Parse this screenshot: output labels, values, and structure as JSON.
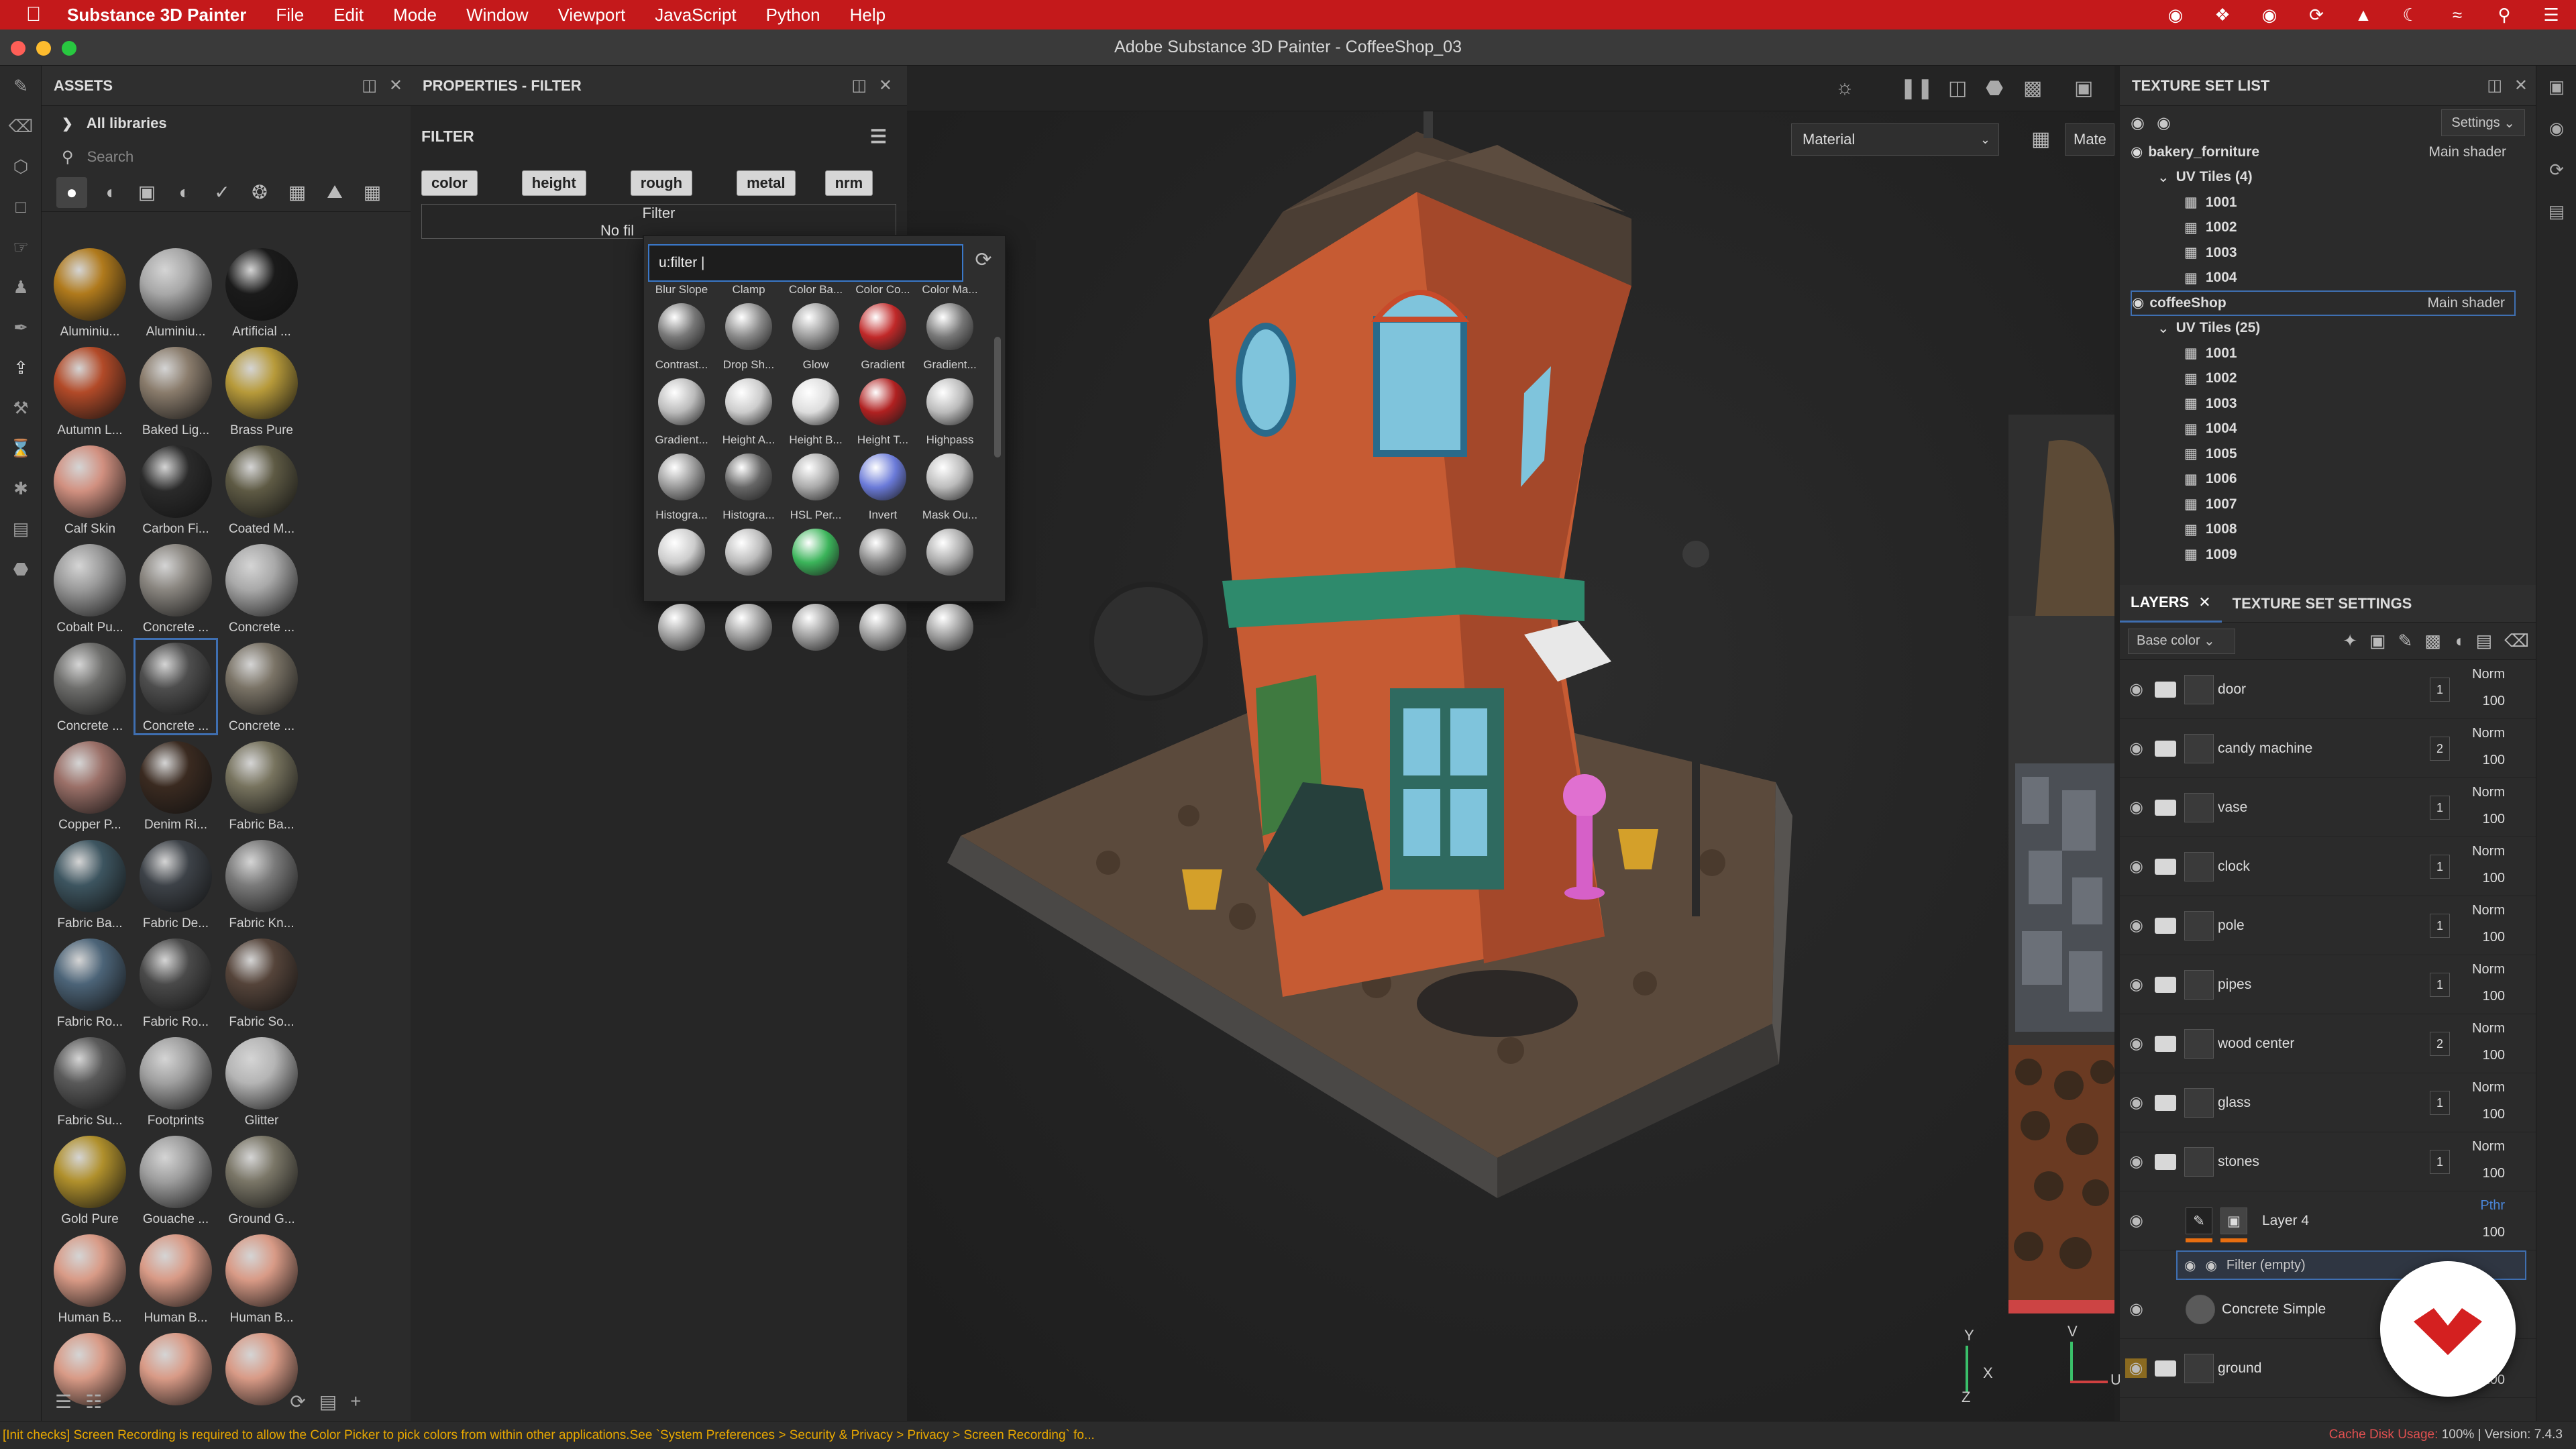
{
  "os_menu": {
    "app_name": "Substance 3D Painter",
    "items": [
      "File",
      "Edit",
      "Mode",
      "Window",
      "Viewport",
      "JavaScript",
      "Python",
      "Help"
    ]
  },
  "window": {
    "title": "Adobe Substance 3D Painter - CoffeeShop_03"
  },
  "assets": {
    "header": "ASSETS",
    "library": "All libraries",
    "search_placeholder": "Search",
    "items": [
      {
        "label": "Aluminiu...",
        "color": "#b07a1c"
      },
      {
        "label": "Aluminiu...",
        "color": "#a8a8a8"
      },
      {
        "label": "Artificial ...",
        "color": "#1a1a1a"
      },
      {
        "label": "Autumn L...",
        "color": "#b24a28"
      },
      {
        "label": "Baked Lig...",
        "color": "#8a7c6c"
      },
      {
        "label": "Brass Pure",
        "color": "#b79a3a"
      },
      {
        "label": "Calf Skin",
        "color": "#d19080"
      },
      {
        "label": "Carbon Fi...",
        "color": "#2a2a2a"
      },
      {
        "label": "Coated M...",
        "color": "#5e5a44"
      },
      {
        "label": "Cobalt Pu...",
        "color": "#9a9a9a"
      },
      {
        "label": "Concrete ...",
        "color": "#8a8680"
      },
      {
        "label": "Concrete ...",
        "color": "#a9a9a9"
      },
      {
        "label": "Concrete ...",
        "color": "#6e6e6c"
      },
      {
        "label": "Concrete ...",
        "color": "#4e4e4e"
      },
      {
        "label": "Concrete ...",
        "color": "#7a7366"
      },
      {
        "label": "Copper P...",
        "color": "#9b7068"
      },
      {
        "label": "Denim Ri...",
        "color": "#3a2a20"
      },
      {
        "label": "Fabric Ba...",
        "color": "#77735e"
      },
      {
        "label": "Fabric Ba...",
        "color": "#3d5560"
      },
      {
        "label": "Fabric De...",
        "color": "#3d4248"
      },
      {
        "label": "Fabric Kn...",
        "color": "#7a7a7a"
      },
      {
        "label": "Fabric Ro...",
        "color": "#4c6478"
      },
      {
        "label": "Fabric Ro...",
        "color": "#4a4a4a"
      },
      {
        "label": "Fabric So...",
        "color": "#55443a"
      },
      {
        "label": "Fabric Su...",
        "color": "#5a5a5a"
      },
      {
        "label": "Footprints",
        "color": "#a0a0a0"
      },
      {
        "label": "Glitter",
        "color": "#b5b5b5"
      },
      {
        "label": "Gold Pure",
        "color": "#b0902c"
      },
      {
        "label": "Gouache ...",
        "color": "#9e9e9e"
      },
      {
        "label": "Ground G...",
        "color": "#7a7667"
      },
      {
        "label": "Human B...",
        "color": "#d89a86"
      },
      {
        "label": "Human B...",
        "color": "#d89a86"
      },
      {
        "label": "Human B...",
        "color": "#d89a86"
      },
      {
        "label": "",
        "color": "#d89a86"
      },
      {
        "label": "",
        "color": "#d89a86"
      },
      {
        "label": "",
        "color": "#d89a86"
      }
    ]
  },
  "properties": {
    "header": "PROPERTIES - FILTER",
    "section": "FILTER",
    "channels": [
      "color",
      "height",
      "rough",
      "metal",
      "nrm"
    ],
    "filter_label": "Filter",
    "filter_value": "No fil"
  },
  "filter_popup": {
    "query": "u:filter |",
    "items": [
      {
        "label": "Blur Slope",
        "color": "#777"
      },
      {
        "label": "Clamp",
        "color": "#888"
      },
      {
        "label": "Color Ba...",
        "color": "#999"
      },
      {
        "label": "Color Co...",
        "color": "#c02828"
      },
      {
        "label": "Color Ma...",
        "color": "#777"
      },
      {
        "label": "Contrast...",
        "color": "#bbb"
      },
      {
        "label": "Drop Sh...",
        "color": "#ccc"
      },
      {
        "label": "Glow",
        "color": "#ddd"
      },
      {
        "label": "Gradient",
        "color": "#b02020"
      },
      {
        "label": "Gradient...",
        "color": "#bbb"
      },
      {
        "label": "Gradient...",
        "color": "#999"
      },
      {
        "label": "Height A...",
        "color": "#666"
      },
      {
        "label": "Height B...",
        "color": "#aaa"
      },
      {
        "label": "Height T...",
        "color": "#6a7ad8"
      },
      {
        "label": "Highpass",
        "color": "#bbb"
      },
      {
        "label": "Histogra...",
        "color": "#ccc"
      },
      {
        "label": "Histogra...",
        "color": "#bbb"
      },
      {
        "label": "HSL Per...",
        "color": "#3bb45a"
      },
      {
        "label": "Invert",
        "color": "#888"
      },
      {
        "label": "Mask Ou...",
        "color": "#aaa"
      },
      {
        "label": "",
        "color": "#9a9a9a"
      },
      {
        "label": "",
        "color": "#9a9a9a"
      },
      {
        "label": "",
        "color": "#9a9a9a"
      },
      {
        "label": "",
        "color": "#9a9a9a"
      },
      {
        "label": "",
        "color": "#9a9a9a"
      }
    ]
  },
  "viewport": {
    "material_select": "Material",
    "material_select2": "Mate",
    "axis_y": "Y",
    "axis_x": "X",
    "axis_z": "Z",
    "axis_u": "U",
    "axis_v": "V"
  },
  "texture_set_list": {
    "header": "TEXTURE SET LIST",
    "settings": "Settings",
    "sets": [
      {
        "name": "bakery_forniture",
        "shader": "Main shader",
        "uv_label": "UV Tiles (4)",
        "tiles": [
          "1001",
          "1002",
          "1003",
          "1004"
        ]
      },
      {
        "name": "coffeeShop",
        "shader": "Main shader",
        "uv_label": "UV Tiles (25)",
        "tiles": [
          "1001",
          "1002",
          "1003",
          "1004",
          "1005",
          "1006",
          "1007",
          "1008",
          "1009"
        ]
      }
    ]
  },
  "layers": {
    "tab_layers": "LAYERS",
    "tab_settings": "TEXTURE SET SETTINGS",
    "channel": "Base color",
    "items": [
      {
        "name": "door",
        "blend": "Norm",
        "opacity": "100",
        "count": "1"
      },
      {
        "name": "candy machine",
        "blend": "Norm",
        "opacity": "100",
        "count": "2"
      },
      {
        "name": "vase",
        "blend": "Norm",
        "opacity": "100",
        "count": "1"
      },
      {
        "name": "clock",
        "blend": "Norm",
        "opacity": "100",
        "count": "1"
      },
      {
        "name": "pole",
        "blend": "Norm",
        "opacity": "100",
        "count": "1"
      },
      {
        "name": "pipes",
        "blend": "Norm",
        "opacity": "100",
        "count": "1"
      },
      {
        "name": "wood center",
        "blend": "Norm",
        "opacity": "100",
        "count": "2"
      },
      {
        "name": "glass",
        "blend": "Norm",
        "opacity": "100",
        "count": "1"
      },
      {
        "name": "stones",
        "blend": "Norm",
        "opacity": "100",
        "count": "1"
      }
    ],
    "paint_layer": {
      "name": "Layer 4",
      "blend": "Pthr",
      "opacity": "100"
    },
    "filter_effect": "Filter (empty)",
    "concrete": "Concrete Simple",
    "ground": {
      "name": "ground",
      "opacity": "100"
    }
  },
  "status": {
    "message": "[Init checks] Screen Recording is required to allow the Color Picker to pick colors from within other applications.See `System Preferences > Security & Privacy > Privacy > Screen Recording` fo...",
    "cache": "Cache Disk Usage:",
    "cache_value": "100%",
    "version": "Version: 7.4.3"
  },
  "colors": {
    "accent": "#3f6fb1",
    "menubar": "#c4191b",
    "warning": "#e8a800"
  }
}
